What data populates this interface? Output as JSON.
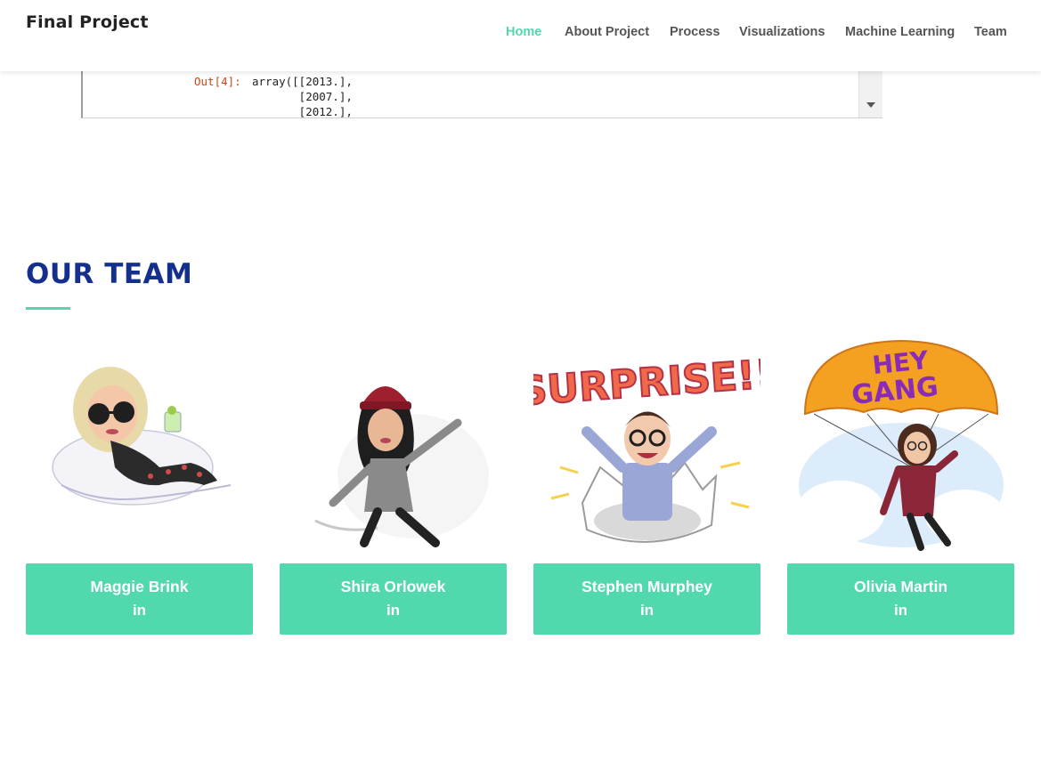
{
  "nav": {
    "brand": "Final Project",
    "links": [
      "Home",
      "About Project",
      "Process",
      "Visualizations",
      "Machine Learning",
      "Team"
    ],
    "active": "Home"
  },
  "notebook": {
    "prompt": "Out[4]:",
    "lines": [
      "array([[2013.],",
      "       [2007.],",
      "       [2012.],"
    ]
  },
  "team": {
    "title": "OUR TEAM",
    "members": [
      {
        "name": "Maggie Brink",
        "social": "in"
      },
      {
        "name": "Shira Orlowek",
        "social": "in"
      },
      {
        "name": "Stephen Murphey",
        "social": "in"
      },
      {
        "name": "Olivia Martin",
        "social": "in"
      }
    ],
    "badges": {
      "surprise": "SURPRISE!!",
      "hey": "HEY",
      "gang": "GANG"
    }
  },
  "colors": {
    "accent": "#52d8ae",
    "title": "#15308c",
    "nav_text": "#555555",
    "prompt": "#d84315"
  }
}
